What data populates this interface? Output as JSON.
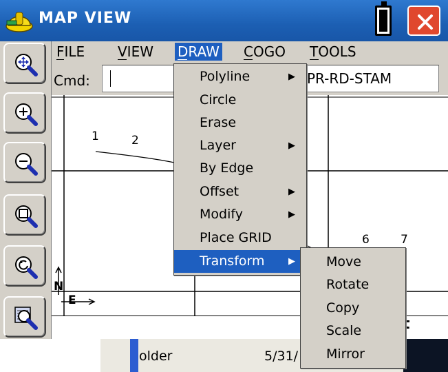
{
  "window": {
    "title": "MAP VIEW"
  },
  "icons": {
    "app": "hardhat-icon",
    "battery": "battery-icon",
    "close": "close-icon"
  },
  "colors": {
    "titlebar": "#1c5fb3",
    "menu_highlight": "#1e5fc0",
    "close_button": "#e0482e"
  },
  "toolbar": {
    "tools": [
      "zoom-extents-icon",
      "zoom-in-icon",
      "zoom-out-icon",
      "zoom-window-icon",
      "zoom-previous-icon",
      "zoom-layer-icon"
    ]
  },
  "menubar": {
    "items": [
      "FILE",
      "VIEW",
      "DRAW",
      "COGO",
      "TOOLS"
    ],
    "active": "DRAW"
  },
  "cmd": {
    "label": "Cmd:",
    "value": "PR-RD-STAM"
  },
  "map": {
    "points": [
      "1",
      "2",
      "6",
      "7"
    ],
    "north_label": "N",
    "east_label": "E",
    "bottom_text": "t"
  },
  "draw_menu": {
    "items": [
      {
        "label": "Polyline",
        "submenu": true
      },
      {
        "label": "Circle",
        "submenu": false
      },
      {
        "label": "Erase",
        "submenu": false
      },
      {
        "label": "Layer",
        "submenu": true
      },
      {
        "label": "By Edge",
        "submenu": false
      },
      {
        "label": "Offset",
        "submenu": true
      },
      {
        "label": "Modify",
        "submenu": true
      },
      {
        "label": "Place GRID",
        "submenu": false
      },
      {
        "label": "Transform",
        "submenu": true,
        "active": true
      }
    ]
  },
  "transform_submenu": {
    "items": [
      "Move",
      "Rotate",
      "Copy",
      "Scale",
      "Mirror"
    ]
  },
  "background": {
    "file_name_partial": "older",
    "date_partial": "5/31/"
  }
}
